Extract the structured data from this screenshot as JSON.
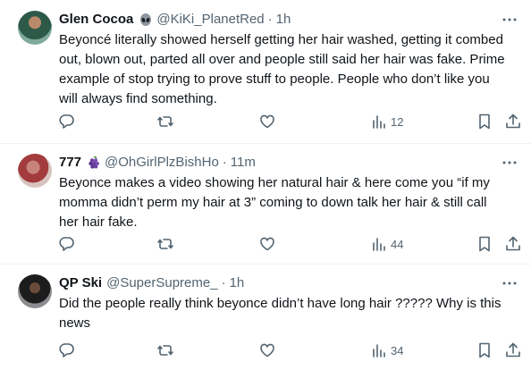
{
  "tweets": [
    {
      "author_name": "Glen Cocoa",
      "badge_icon": "alien-emoji-icon",
      "handle": "@KiKi_PlanetRed",
      "time": "1h",
      "text": "Beyoncé literally showed herself getting her hair washed, getting it combed out, blown out, parted all over and people still said her hair was fake. Prime example of stop trying to prove stuff to people. People who don’t like you will always find something.",
      "views": "12"
    },
    {
      "author_name": "777",
      "badge_icon": "grapes-emoji-icon",
      "handle": "@OhGirlPlzBishHo",
      "time": "11m",
      "text": "Beyonce makes a video showing her natural hair & here come you “if my momma didn’t perm my hair at 3” coming to down talk her hair & still call her hair fake.",
      "views": "44"
    },
    {
      "author_name": "QP Ski",
      "handle": "@SuperSupreme_",
      "time": "1h",
      "text": "Did the people really think beyonce didn’t have long hair ????? Why is this news",
      "views": "34"
    }
  ],
  "separator": "·",
  "colors": {
    "text": "#0f1419",
    "secondary": "#536471",
    "divider": "#eff3f4"
  }
}
